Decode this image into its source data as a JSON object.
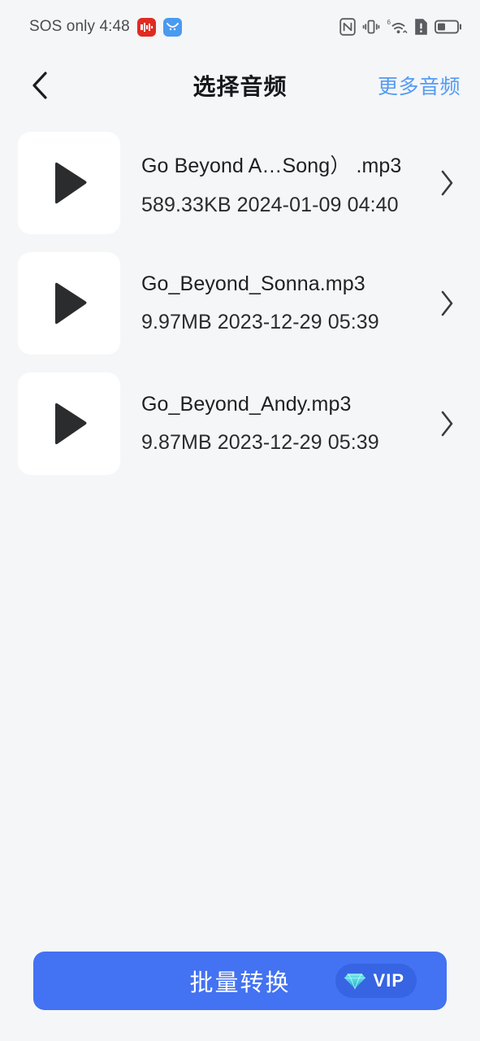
{
  "status_bar": {
    "carrier": "SOS only",
    "time": "4:48",
    "app_badges": [
      {
        "name": "recorder-app-badge",
        "color": "#e02b22"
      },
      {
        "name": "browser-app-badge",
        "color": "#4a9af0"
      }
    ],
    "icons": [
      "nfc-icon",
      "vibrate-icon",
      "wifi-6-icon",
      "sim-alert-icon",
      "battery-icon"
    ],
    "wifi_generation": "6"
  },
  "header": {
    "back_icon": "chevron-left-icon",
    "title": "选择音频",
    "more_link": "更多音频",
    "link_color": "#549bf2"
  },
  "audio_list": [
    {
      "name": "Go Beyond A…Song） .mp3",
      "size": "589.33KB",
      "date": "2024-01-09 04:40",
      "meta": "589.33KB 2024-01-09 04:40",
      "thumb_icon": "play-icon",
      "chevron_icon": "chevron-right-icon"
    },
    {
      "name": "Go_Beyond_Sonna.mp3",
      "size": "9.97MB",
      "date": "2023-12-29 05:39",
      "meta": "9.97MB 2023-12-29 05:39",
      "thumb_icon": "play-icon",
      "chevron_icon": "chevron-right-icon"
    },
    {
      "name": "Go_Beyond_Andy.mp3",
      "size": "9.87MB",
      "date": "2023-12-29 05:39",
      "meta": "9.87MB 2023-12-29 05:39",
      "thumb_icon": "play-icon",
      "chevron_icon": "chevron-right-icon"
    }
  ],
  "bottom_action": {
    "label": "批量转换",
    "vip_label": "VIP",
    "vip_icon": "diamond-icon",
    "button_color": "#4372f2",
    "badge_color": "#3764e3"
  }
}
